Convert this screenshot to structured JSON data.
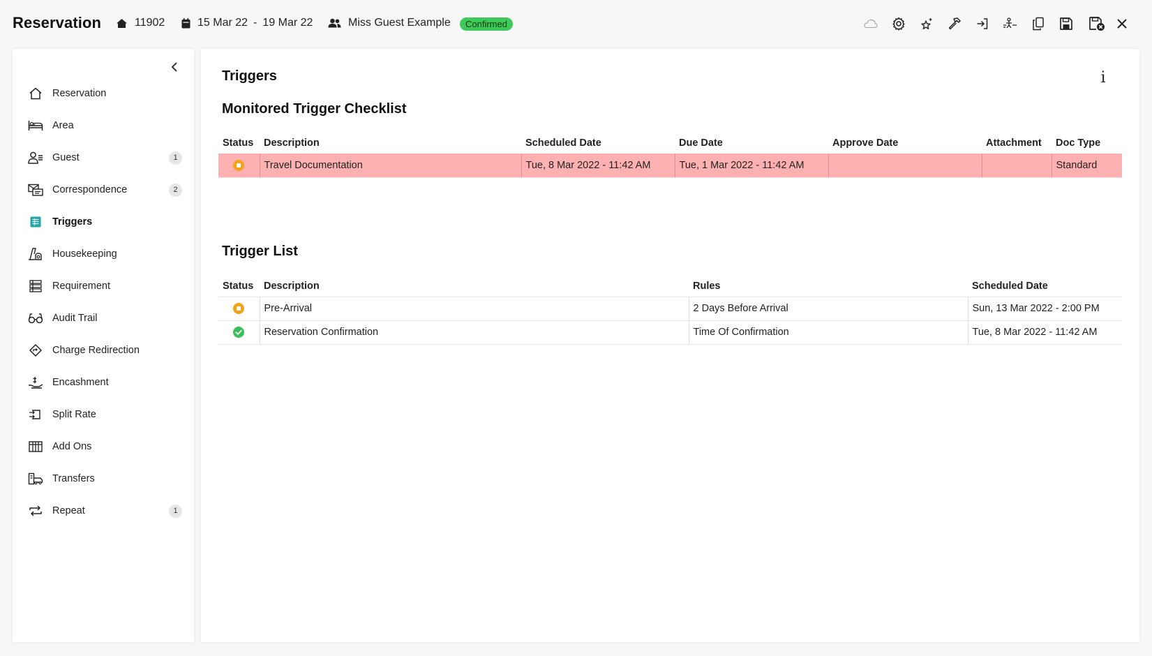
{
  "header": {
    "title": "Reservation",
    "reservation_number": "11902",
    "date_from": "15 Mar 22",
    "date_sep": "-",
    "date_to": "19 Mar 22",
    "guest_name": "Miss Guest Example",
    "status": "Confirmed",
    "status_color": "#3ec95a",
    "tools": [
      "cloud-icon",
      "gear-icon",
      "sparkle-star-icon",
      "hammer-icon",
      "sign-in-icon",
      "checkin-icon",
      "copy-icon",
      "save-icon",
      "save-close-icon",
      "close-icon"
    ]
  },
  "sidebar": {
    "items": [
      {
        "label": "Reservation",
        "icon": "home-icon",
        "count": null,
        "active": false
      },
      {
        "label": "Area",
        "icon": "bed-icon",
        "count": null,
        "active": false
      },
      {
        "label": "Guest",
        "icon": "guest-icon",
        "count": "1",
        "active": false
      },
      {
        "label": "Correspondence",
        "icon": "correspondence-icon",
        "count": "2",
        "active": false
      },
      {
        "label": "Triggers",
        "icon": "triggers-icon",
        "count": null,
        "active": true
      },
      {
        "label": "Housekeeping",
        "icon": "housekeeping-icon",
        "count": null,
        "active": false
      },
      {
        "label": "Requirement",
        "icon": "requirement-icon",
        "count": null,
        "active": false
      },
      {
        "label": "Audit Trail",
        "icon": "glasses-icon",
        "count": null,
        "active": false
      },
      {
        "label": "Charge Redirection",
        "icon": "redirect-icon",
        "count": null,
        "active": false
      },
      {
        "label": "Encashment",
        "icon": "encashment-icon",
        "count": null,
        "active": false
      },
      {
        "label": "Split Rate",
        "icon": "split-rate-icon",
        "count": null,
        "active": false
      },
      {
        "label": "Add Ons",
        "icon": "add-ons-icon",
        "count": null,
        "active": false
      },
      {
        "label": "Transfers",
        "icon": "transfers-icon",
        "count": null,
        "active": false
      },
      {
        "label": "Repeat",
        "icon": "repeat-icon",
        "count": "1",
        "active": false
      }
    ]
  },
  "main": {
    "title": "Triggers",
    "info_label": "i",
    "checklist": {
      "title": "Monitored Trigger Checklist",
      "columns": [
        "Status",
        "Description",
        "Scheduled Date",
        "Due Date",
        "Approve Date",
        "Attachment",
        "Doc Type"
      ],
      "rows": [
        {
          "status": "pending",
          "description": "Travel Documentation",
          "scheduled": "Tue, 8 Mar 2022 - 11:42 AM",
          "due": "Tue, 1 Mar 2022 - 11:42 AM",
          "approve": "",
          "attachment": "",
          "doc_type": "Standard",
          "highlight_color": "#ffb0b0"
        }
      ]
    },
    "trigger_list": {
      "title": "Trigger List",
      "columns": [
        "Status",
        "Description",
        "Rules",
        "Scheduled Date"
      ],
      "rows": [
        {
          "status": "pending",
          "description": "Pre-Arrival",
          "rules": "2 Days Before Arrival",
          "scheduled": "Sun, 13 Mar 2022 - 2:00 PM"
        },
        {
          "status": "done",
          "description": "Reservation Confirmation",
          "rules": "Time Of Confirmation",
          "scheduled": "Tue, 8 Mar 2022 - 11:42 AM"
        }
      ]
    }
  }
}
